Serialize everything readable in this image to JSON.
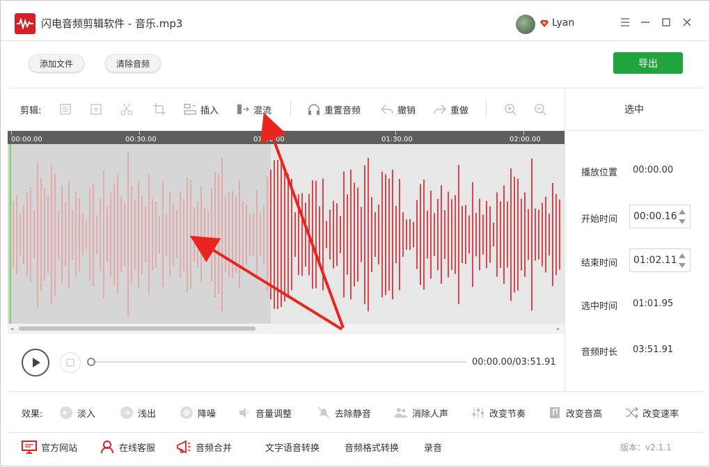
{
  "app": {
    "title": "闪电音频剪辑软件 - 音乐.mp3",
    "username": "Lyan"
  },
  "window_controls": [
    "menu",
    "minimize",
    "maximize",
    "close"
  ],
  "top_buttons": {
    "add_file": "添加文件",
    "clear_audio": "清除音频",
    "export": "导出"
  },
  "edit_toolbar": {
    "label": "剪辑:",
    "insert": "插入",
    "mix": "混流",
    "reset_audio": "重置音频",
    "undo": "撤销",
    "redo": "重做"
  },
  "timeline": {
    "ticks": [
      "00:00.00",
      "00:30.00",
      "01:00.00",
      "01:30.00",
      "02:00.00"
    ]
  },
  "waveform": {
    "selected_fraction": 0.48,
    "colors": {
      "selected": "#e8a0a0",
      "unselected": "#d01f25",
      "background": "#e7e7e7",
      "selection_bg": "#d6d6d6"
    }
  },
  "playback": {
    "time": "00:00.00/03:51.91"
  },
  "right_panel": {
    "header": "选中",
    "play_position_label": "播放位置",
    "play_position": "00:00.00",
    "start_label": "开始时间",
    "start": "00:00.16",
    "end_label": "结束时间",
    "end": "01:02.11",
    "selected_label": "选中时间",
    "selected": "01:01.95",
    "duration_label": "音频时长",
    "duration": "03:51.91"
  },
  "effects": {
    "label": "效果:",
    "items": [
      "淡入",
      "浅出",
      "降噪",
      "音量调整",
      "去除静音",
      "消除人声",
      "改变节奏",
      "改变音高",
      "改变速率"
    ]
  },
  "bottom_bar": {
    "items": [
      "官方网站",
      "在线客服",
      "音频合并",
      "文字语音转换",
      "音频格式转换",
      "录音"
    ],
    "version": "版本：v2.1.1"
  },
  "colors": {
    "accent_green": "#21a33e",
    "brand_red": "#d81f26",
    "arrow_red": "#e8261f"
  }
}
